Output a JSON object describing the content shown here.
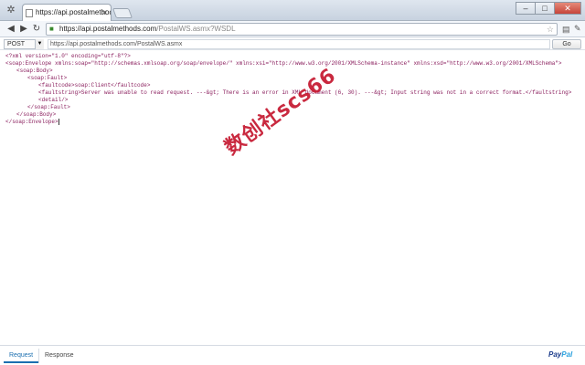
{
  "window": {
    "tab_title": "https://api.postalmethods.com"
  },
  "toolbar": {
    "url_host": "https://api.postalmethods.com",
    "url_path": "/PostalWS.asmx?WSDL"
  },
  "request": {
    "method": "POST",
    "url": "https://api.postalmethods.com/PostalWS.asmx",
    "go_label": "Go"
  },
  "xml": {
    "l1": "<?xml version=\"1.0\" encoding=\"utf-8\"?>",
    "l2": "<soap:Envelope xmlns:soap=\"http://schemas.xmlsoap.org/soap/envelope/\" xmlns:xsi=\"http://www.w3.org/2001/XMLSchema-instance\" xmlns:xsd=\"http://www.w3.org/2001/XMLSchema\">",
    "l3": "<soap:Body>",
    "l4": "<soap:Fault>",
    "l5": "<faultcode>soap:Client</faultcode>",
    "l6": "<faultstring>Server was unable to read request. ---&gt; There is an error in XML document (6, 30). ---&gt; Input string was not in a correct format.</faultstring>",
    "l7": "<detail/>",
    "l8": "</soap:Fault>",
    "l9": "</soap:Body>",
    "l10": "</soap:Envelope>"
  },
  "watermark": "数创社scs66",
  "bottom": {
    "tab_request": "Request",
    "tab_response": "Response",
    "brand_a": "Pay",
    "brand_b": "Pal"
  },
  "colors": {
    "tag": "#8a1e5d",
    "string": "#1a3ba8",
    "active_tab": "#1b6fb0"
  }
}
